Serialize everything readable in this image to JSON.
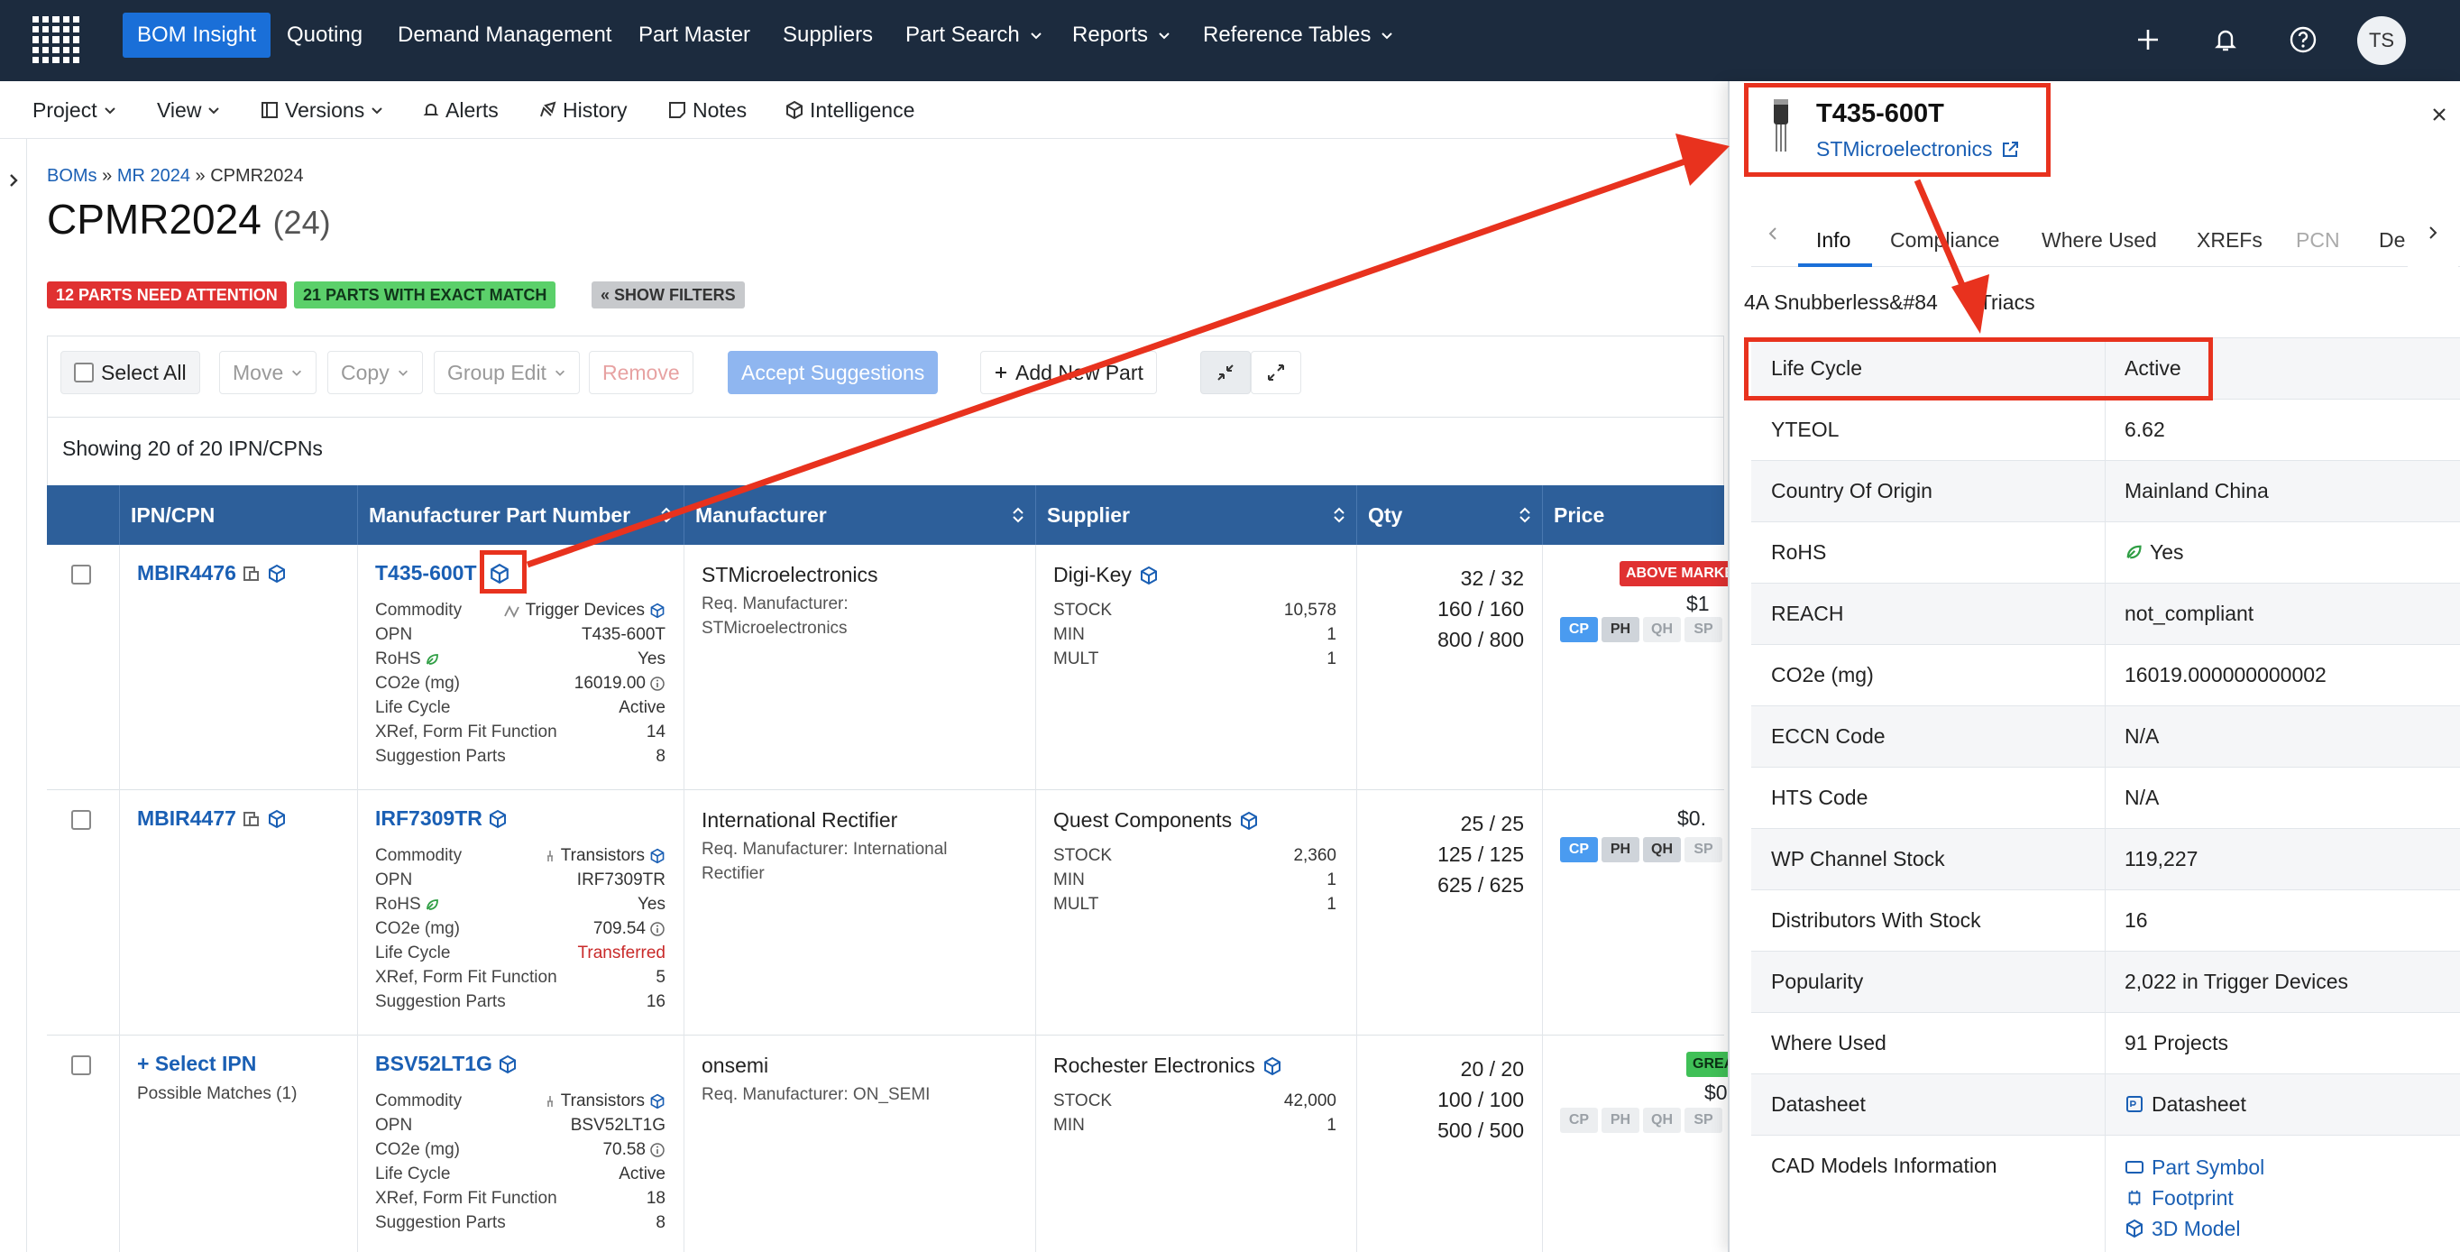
{
  "topnav": {
    "items": [
      "BOM Insight",
      "Quoting",
      "Demand Management",
      "Part Master",
      "Suppliers",
      "Part Search",
      "Reports",
      "Reference Tables"
    ],
    "active": "BOM Insight",
    "avatar": "TS"
  },
  "subbar": {
    "items": [
      "Project",
      "View",
      "Versions",
      "Alerts",
      "History",
      "Notes",
      "Intelligence"
    ]
  },
  "breadcrumb": {
    "root": "BOMs",
    "mid": "MR 2024",
    "current": "CPMR2024"
  },
  "page": {
    "title": "CPMR2024",
    "count": "(24)"
  },
  "badges": {
    "attention": "12 PARTS NEED ATTENTION",
    "exact": "21 PARTS WITH EXACT MATCH",
    "filters": "« SHOW FILTERS"
  },
  "actions": {
    "select_all": "Select All",
    "move": "Move",
    "copy": "Copy",
    "group_edit": "Group Edit",
    "remove": "Remove",
    "accept": "Accept Suggestions",
    "add": "Add New Part"
  },
  "showing": "Showing 20 of 20 IPN/CPNs",
  "table": {
    "headers": [
      "IPN/CPN",
      "Manufacturer Part Number",
      "Manufacturer",
      "Supplier",
      "Qty",
      "Price"
    ],
    "labels": {
      "commodity": "Commodity",
      "opn": "OPN",
      "rohs": "RoHS",
      "co2": "CO2e (mg)",
      "lifecycle": "Life Cycle",
      "xref": "XRef, Form Fit Function",
      "suggest": "Suggestion Parts",
      "stock": "STOCK",
      "min": "MIN",
      "mult": "MULT"
    },
    "rows": [
      {
        "ipn": "MBIR4476",
        "mpn": "T435-600T",
        "commodity": "Trigger Devices",
        "opn": "T435-600T",
        "rohs": "Yes",
        "co2": "16019.00",
        "lifecycle": "Active",
        "xref": "14",
        "suggest": "8",
        "manufacturer": "STMicroelectronics",
        "req_label": "Req. Manufacturer:",
        "req_value": "STMicroelectronics",
        "supplier": "Digi-Key",
        "stock": "10,578",
        "min": "1",
        "mult": "1",
        "qty": [
          "32 / 32",
          "160 / 160",
          "800 / 800"
        ],
        "price_tag": "ABOVE MARKE",
        "price": "$1"
      },
      {
        "ipn": "MBIR4477",
        "mpn": "IRF7309TR",
        "commodity": "Transistors",
        "opn": "IRF7309TR",
        "rohs": "Yes",
        "co2": "709.54",
        "lifecycle": "Transferred",
        "xref": "5",
        "suggest": "16",
        "manufacturer": "International Rectifier",
        "req_label": "Req. Manufacturer: International",
        "req_value": "Rectifier",
        "supplier": "Quest Components",
        "stock": "2,360",
        "min": "1",
        "mult": "1",
        "qty": [
          "25 / 25",
          "125 / 125",
          "625 / 625"
        ],
        "price": "$0."
      },
      {
        "ipn": "+ Select IPN",
        "ipn_sub": "Possible Matches (1)",
        "mpn": "BSV52LT1G",
        "commodity": "Transistors",
        "opn": "BSV52LT1G",
        "co2": "70.58",
        "lifecycle": "Active",
        "xref": "18",
        "suggest": "8",
        "manufacturer": "onsemi",
        "req_label": "Req. Manufacturer: ON_SEMI",
        "supplier": "Rochester Electronics",
        "stock": "42,000",
        "min": "1",
        "qty": [
          "20 / 20",
          "100 / 100",
          "500 / 500"
        ],
        "price_tag": "GREAT PRIC",
        "price": "$0"
      }
    ],
    "chips": [
      "CP",
      "PH",
      "QH",
      "SP"
    ]
  },
  "panel": {
    "part": "T435-600T",
    "maker": "STMicroelectronics",
    "tabs": [
      "Info",
      "Compliance",
      "Where Used",
      "XREFs",
      "PCN",
      "De"
    ],
    "description": "4A Snubberless&#84",
    "description_tail": "Triacs",
    "rows": [
      {
        "k": "Life Cycle",
        "v": "Active"
      },
      {
        "k": "YTEOL",
        "v": "6.62"
      },
      {
        "k": "Country Of Origin",
        "v": "Mainland China"
      },
      {
        "k": "RoHS",
        "v": "Yes"
      },
      {
        "k": "REACH",
        "v": "not_compliant"
      },
      {
        "k": "CO2e (mg)",
        "v": "16019.000000000002"
      },
      {
        "k": "ECCN Code",
        "v": "N/A"
      },
      {
        "k": "HTS Code",
        "v": "N/A"
      },
      {
        "k": "WP Channel Stock",
        "v": "119,227"
      },
      {
        "k": "Distributors With Stock",
        "v": "16"
      },
      {
        "k": "Popularity",
        "v": "2,022 in Trigger Devices"
      },
      {
        "k": "Where Used",
        "v": "91 Projects"
      },
      {
        "k": "Datasheet",
        "v": "Datasheet"
      },
      {
        "k": "CAD Models Information",
        "v": "Part Symbol",
        "v2": "Footprint",
        "v3": "3D Model"
      }
    ]
  },
  "colors": {
    "nav": "#1c2b3e",
    "active": "#1a6fd8",
    "header": "#2d5f9a",
    "link": "#1a5fb4",
    "annotation": "#e8321e",
    "attention": "#e03131",
    "exact": "#5bd06a"
  }
}
